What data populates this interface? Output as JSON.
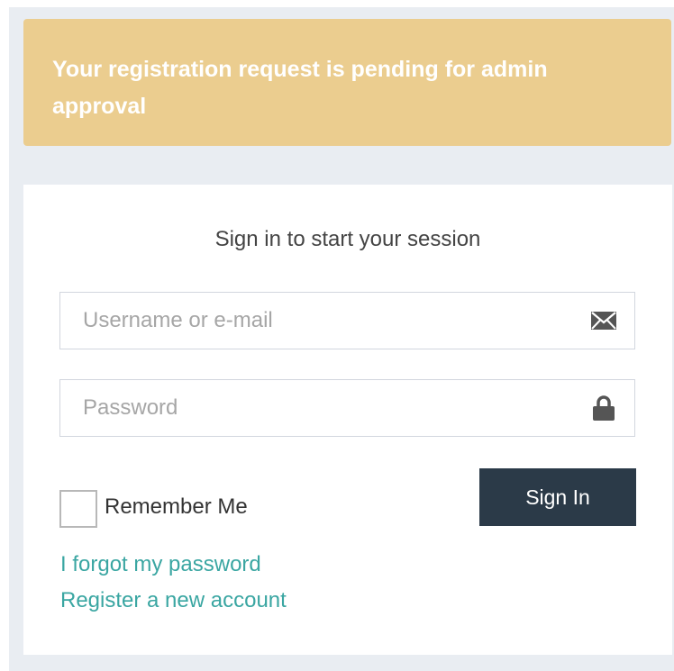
{
  "alert": {
    "message": "Your registration request is pending for admin approval"
  },
  "login": {
    "box_message": "Sign in to start your session",
    "username": {
      "placeholder": "Username or e-mail",
      "value": "",
      "icon": "envelope-icon"
    },
    "password": {
      "placeholder": "Password",
      "value": "",
      "icon": "lock-icon"
    },
    "remember_label": "Remember Me",
    "remember_checked": false,
    "signin_label": "Sign In",
    "forgot_link": "I forgot my password",
    "register_link": "Register a new account"
  },
  "colors": {
    "alert_bg": "#ebcd8f",
    "page_bg": "#e9edf2",
    "button_bg": "#2b3a48",
    "link": "#3aa6a2"
  }
}
